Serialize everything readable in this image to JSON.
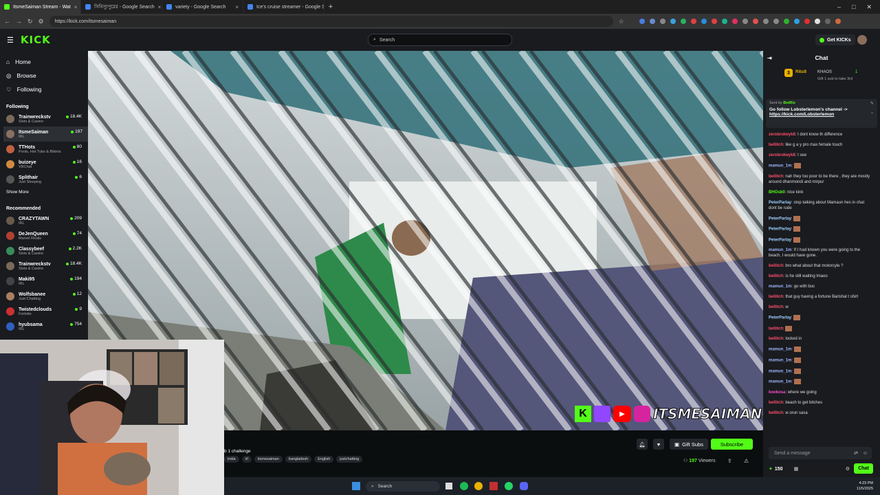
{
  "browser": {
    "tabs": [
      {
        "title": "ItsmeSaiman Stream - Wat",
        "color": "#53fc18",
        "active": true
      },
      {
        "title": "সিনিস্যুপুরের - Google Search",
        "color": "#4285f4",
        "active": false
      },
      {
        "title": "variety - Google Search",
        "color": "#4285f4",
        "active": false
      },
      {
        "title": "Ice's cruise streamer - Google S",
        "color": "#4285f4",
        "active": false
      }
    ],
    "url": "https://kick.com/itsmesaiman"
  },
  "header": {
    "logo": "KICK",
    "search_placeholder": "Search",
    "get_kicks": "Get KICKs"
  },
  "sidebar": {
    "nav": [
      {
        "label": "Home",
        "icon": "home-icon"
      },
      {
        "label": "Browse",
        "icon": "compass-icon"
      },
      {
        "label": "Following",
        "icon": "heart-icon"
      }
    ],
    "following_title": "Following",
    "following": [
      {
        "name": "Trainwreckstv",
        "category": "Slots & Casino",
        "viewers": "18.4K",
        "color": "#7a6a5a"
      },
      {
        "name": "ItsmeSaiman",
        "category": "IRL",
        "viewers": "197",
        "color": "#8a7060"
      },
      {
        "name": "TTHots",
        "category": "Pools, Hot Tubs & Bikinis",
        "viewers": "80",
        "color": "#c06040"
      },
      {
        "name": "buizeye",
        "category": "VRChat",
        "viewers": "16",
        "color": "#d08a40"
      },
      {
        "name": "Splithair",
        "category": "Just Sleeping",
        "viewers": "6",
        "color": "#555"
      }
    ],
    "show_more": "Show More",
    "recommended_title": "Recommended",
    "recommended": [
      {
        "name": "CRAZYTAWN",
        "category": "IRL",
        "viewers": "209",
        "color": "#6a5a4a"
      },
      {
        "name": "DeJenQueen",
        "category": "Marvel Rivals",
        "viewers": "74",
        "color": "#b04030"
      },
      {
        "name": "Classybeef",
        "category": "Slots & Casino",
        "viewers": "2.2K",
        "color": "#3a8a5a"
      },
      {
        "name": "Trainwreckstv",
        "category": "Slots & Casino",
        "viewers": "18.4K",
        "color": "#7a6a5a"
      },
      {
        "name": "Maki95",
        "category": "IRL",
        "viewers": "194",
        "color": "#444"
      },
      {
        "name": "Wolfsbanee",
        "category": "Just Chatting",
        "viewers": "12",
        "color": "#aa8060"
      },
      {
        "name": "Twistedclouds",
        "category": "Fortnite",
        "viewers": "9",
        "color": "#cc3030"
      },
      {
        "name": "hyubsama",
        "category": "IRL",
        "viewers": "754",
        "color": "#3060c0"
      }
    ]
  },
  "video": {
    "watermark": "ITSMESAIMAN"
  },
  "below_video": {
    "title": "b 1 challenge",
    "tags": [
      "india",
      "irl",
      "itsmesaiman",
      "bangladesh",
      "English",
      "justchatting"
    ],
    "gift_subs": "Gift Subs",
    "subscribe": "Subscribe",
    "viewers_count": "197",
    "viewers_label": "Viewers"
  },
  "chat": {
    "title": "Chat",
    "top_gifter": {
      "name": "Ribz8",
      "rank": "3",
      "name2": "KHAOS",
      "count": "1",
      "note": "Gift 1 sub to take 3rd"
    },
    "pinned": {
      "sender_prefix": "Sent by",
      "sender": "BotRix",
      "line1": "Go follow Lobsterlemon's channel ->",
      "link": "https://kick.com/Lobsterlemon"
    },
    "messages": [
      {
        "user": "zerobrokeyk8",
        "color": "#ff4d6a",
        "text": "I dont know th difference"
      },
      {
        "user": "bellitch",
        "color": "#ff4d6a",
        "text": "like g a y pro max female touch"
      },
      {
        "user": "zerobrokeyk8",
        "color": "#ff4d6a",
        "text": "I see"
      },
      {
        "user": "mamun_1m",
        "color": "#9fb6ff",
        "text": ""
      },
      {
        "user": "bellitch",
        "color": "#ff4d6a",
        "text": "nah they too poor to be there , they are mostly around dhanmondi and mirpur"
      },
      {
        "user": "BHOsb0",
        "color": "#53fc18",
        "text": "nice kink"
      },
      {
        "user": "PeterParlay",
        "color": "#9fd0ff",
        "text": "stop talking about Mamaun hes in chat dont be rude"
      },
      {
        "user": "PeterParlay",
        "color": "#9fd0ff",
        "text": ""
      },
      {
        "user": "PeterParlay",
        "color": "#9fd0ff",
        "text": ""
      },
      {
        "user": "PeterParlay",
        "color": "#9fd0ff",
        "text": ""
      },
      {
        "user": "mamun_1m",
        "color": "#9fb6ff",
        "text": "If I had known you were going to the beach, I would have gone."
      },
      {
        "user": "bellitch",
        "color": "#ff4d6a",
        "text": "bro what about that motorcyle ?"
      },
      {
        "user": "bellitch",
        "color": "#ff4d6a",
        "text": "is he still waiting lmaoo"
      },
      {
        "user": "mamun_1m",
        "color": "#9fb6ff",
        "text": "go with bus"
      },
      {
        "user": "bellitch",
        "color": "#ff4d6a",
        "text": "that guy having a fortune Barishal t shirt"
      },
      {
        "user": "bellitch",
        "color": "#ff4d6a",
        "text": "w"
      },
      {
        "user": "PeterParlay",
        "color": "#9fd0ff",
        "text": ""
      },
      {
        "user": "bellitch",
        "color": "#ff4d6a",
        "text": ""
      },
      {
        "user": "bellitch",
        "color": "#ff4d6a",
        "text": "locked in"
      },
      {
        "user": "mamun_1m",
        "color": "#9fb6ff",
        "text": ""
      },
      {
        "user": "mamun_1m",
        "color": "#9fb6ff",
        "text": ""
      },
      {
        "user": "mamun_1m",
        "color": "#9fb6ff",
        "text": ""
      },
      {
        "user": "mamun_1m",
        "color": "#9fb6ff",
        "text": ""
      },
      {
        "user": "kookosa",
        "color": "#ff4dd2",
        "text": "where we going"
      },
      {
        "user": "bellitch",
        "color": "#ff4d6a",
        "text": "beach to get bitches"
      },
      {
        "user": "bellitch",
        "color": "#ff4d6a",
        "text": "w orun sasa"
      }
    ],
    "input_placeholder": "Send a message",
    "points": "150",
    "send_label": "Chat"
  },
  "taskbar": {
    "search": "Search",
    "time": "4:23 PM",
    "date": "11/5/2025"
  }
}
